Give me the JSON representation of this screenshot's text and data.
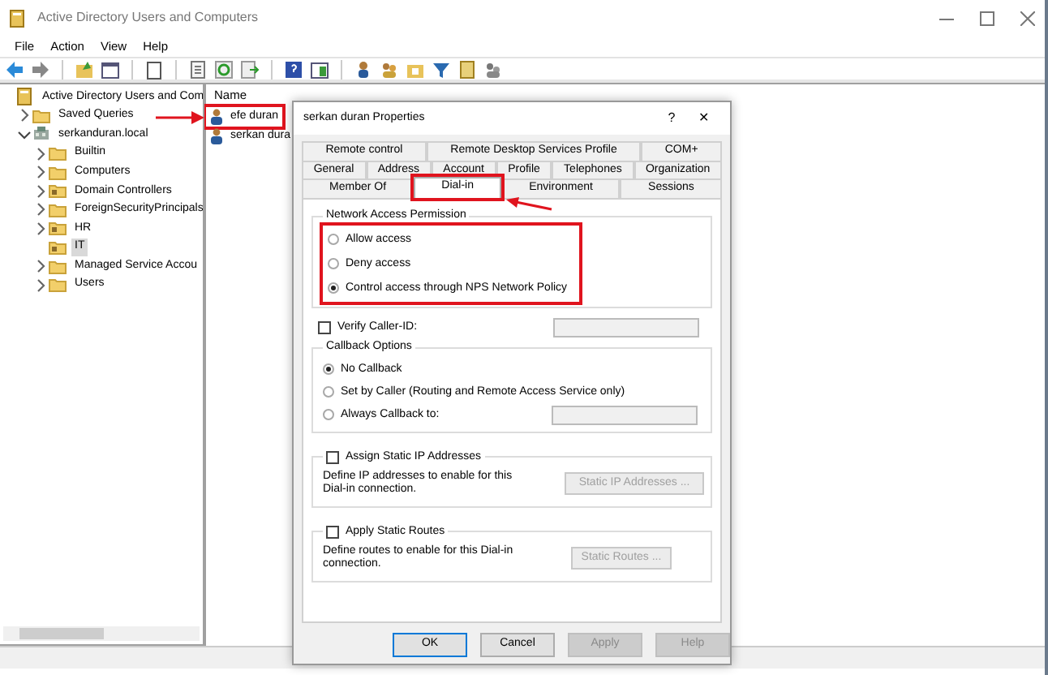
{
  "window": {
    "title": "Active Directory Users and Computers"
  },
  "menu": [
    "File",
    "Action",
    "View",
    "Help"
  ],
  "tree": [
    {
      "label": "Active Directory Users and Com",
      "kind": "console",
      "selected": false,
      "children": [
        {
          "label": "Saved Queries",
          "kind": "folder",
          "expanded": false,
          "selected": false
        },
        {
          "label": "serkanduran.local",
          "kind": "domain",
          "expanded": true,
          "selected": false,
          "children": [
            {
              "label": "Builtin",
              "kind": "folder",
              "expanded": false,
              "selected": false
            },
            {
              "label": "Computers",
              "kind": "folder",
              "expanded": false,
              "selected": false
            },
            {
              "label": "Domain Controllers",
              "kind": "unit",
              "expanded": false,
              "selected": false
            },
            {
              "label": "ForeignSecurityPrincipals",
              "kind": "folder",
              "expanded": false,
              "selected": false
            },
            {
              "label": "HR",
              "kind": "unit",
              "expanded": false,
              "selected": false
            },
            {
              "label": "IT",
              "kind": "unit",
              "selected": true
            },
            {
              "label": "Managed Service Accou",
              "kind": "folder",
              "expanded": false,
              "selected": false
            },
            {
              "label": "Users",
              "kind": "folder",
              "expanded": false,
              "selected": false
            }
          ]
        }
      ]
    }
  ],
  "list": {
    "columns": [
      "Name"
    ],
    "rows": [
      {
        "name": "efe duran",
        "highlighted": true
      },
      {
        "name": "serkan dura",
        "highlighted": false
      }
    ]
  },
  "dialog": {
    "title": "serkan duran Properties",
    "title_buttons": [
      "?",
      "✕"
    ],
    "tab_rows": [
      [
        {
          "label": "Remote control",
          "selected": false,
          "highlighted": false
        },
        {
          "label": "Remote Desktop Services Profile",
          "selected": false,
          "highlighted": false
        },
        {
          "label": "COM+",
          "selected": false,
          "highlighted": false
        }
      ],
      [
        {
          "label": "General",
          "selected": false,
          "highlighted": false
        },
        {
          "label": "Address",
          "selected": false,
          "highlighted": false
        },
        {
          "label": "Account",
          "selected": false,
          "highlighted": false
        },
        {
          "label": "Profile",
          "selected": false,
          "highlighted": false
        },
        {
          "label": "Telephones",
          "selected": false,
          "highlighted": false
        },
        {
          "label": "Organization",
          "selected": false,
          "highlighted": false
        }
      ],
      [
        {
          "label": "Member Of",
          "selected": false,
          "highlighted": false
        },
        {
          "label": "Dial-in",
          "selected": true,
          "highlighted": true
        },
        {
          "label": "Environment",
          "selected": false,
          "highlighted": false
        },
        {
          "label": "Sessions",
          "selected": false,
          "highlighted": false
        }
      ]
    ],
    "network_access": {
      "title": "Network Access Permission",
      "highlighted": true,
      "options": [
        {
          "label": "Allow access",
          "selected": false
        },
        {
          "label": "Deny access",
          "selected": false
        },
        {
          "label": "Control access through NPS Network Policy",
          "selected": true
        }
      ]
    },
    "verify_caller_id": {
      "label": "Verify Caller-ID:",
      "checked": false
    },
    "callback": {
      "title": "Callback Options",
      "options": [
        {
          "label": "No Callback",
          "selected": true,
          "kind": "plain"
        },
        {
          "label": "Set by Caller (Routing and Remote Access Service only)",
          "selected": false,
          "kind": "plain"
        },
        {
          "label": "Always Callback to:",
          "selected": false,
          "kind": "with_field"
        }
      ]
    },
    "static_groups": [
      {
        "label": "Assign Static IP Addresses",
        "checked": false,
        "description": "Define IP addresses to enable for this Dial-in connection.",
        "button": "Static IP Addresses ...",
        "button_disabled": true
      },
      {
        "label": "Apply Static Routes",
        "checked": false,
        "description": "Define routes to enable for this Dial-in connection.",
        "button": "Static Routes ...",
        "button_disabled": true
      }
    ],
    "buttons": [
      {
        "label": "OK",
        "default": true,
        "disabled": false
      },
      {
        "label": "Cancel",
        "default": false,
        "disabled": false
      },
      {
        "label": "Apply",
        "default": false,
        "disabled": true
      },
      {
        "label": "Help",
        "default": false,
        "disabled": true
      }
    ]
  }
}
